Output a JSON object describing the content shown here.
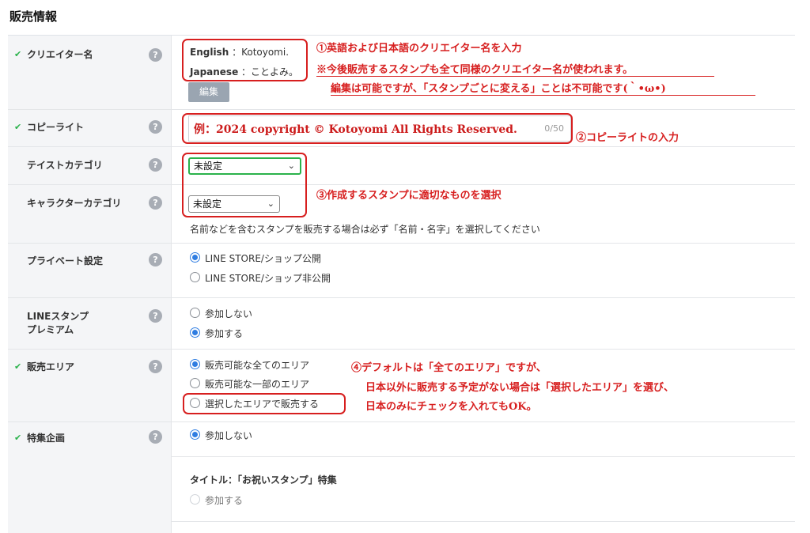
{
  "page_title": "販売情報",
  "help_glyph": "?",
  "check_glyph": "✔",
  "rows": {
    "creator": {
      "label": "クリエイター名",
      "english_label": "English",
      "english_value": "：Kotoyomi.",
      "japanese_label": "Japanese",
      "japanese_value": "：ことよみ。",
      "edit_button": "編集"
    },
    "copyright": {
      "label": "コピーライト",
      "placeholder": "例：2024 copyright © Kotoyomi All Rights Reserved.",
      "count": "0/50"
    },
    "taste": {
      "label": "テイストカテゴリ",
      "selected": "未設定"
    },
    "character": {
      "label": "キャラクターカテゴリ",
      "selected": "未設定",
      "note": "名前などを含むスタンプを販売する場合は必ず「名前・名字」を選択してください"
    },
    "private": {
      "label": "プライベート設定",
      "options": [
        "LINE STORE/ショップ公開",
        "LINE STORE/ショップ非公開"
      ],
      "selected_index": 0
    },
    "premium": {
      "label_line1": "LINEスタンプ",
      "label_line2": "プレミアム",
      "options": [
        "参加しない",
        "参加する"
      ],
      "selected_index": 1
    },
    "area": {
      "label": "販売エリア",
      "options": [
        "販売可能な全てのエリア",
        "販売可能な一部のエリア",
        "選択したエリアで販売する"
      ],
      "selected_index": 0
    },
    "feature": {
      "label": "特集企画",
      "option_top": "参加しない",
      "title_text": "タイトル：「お祝いスタンプ」特集",
      "option_bottom": "参加する"
    }
  },
  "annotations": {
    "a1_line1": "①英語および日本語のクリエイター名を入力",
    "a1_line2": "※今後販売するスタンプも全て同様のクリエイター名が使われます。",
    "a1_line3": "編集は可能ですが、「スタンプごとに変える」ことは不可能です(｀•ω•)",
    "a2": "②コピーライトの入力",
    "a3": "③作成するスタンプに適切なものを選択",
    "a4_line1": "④デフォルトは「全てのエリア」ですが、",
    "a4_line2": "日本以外に販売する予定がない場合は「選択したエリア」を選び、",
    "a4_line3": "日本のみにチェックを入れてもOK。"
  },
  "colors": {
    "annotation_red": "#d71f1f",
    "check_green": "#2ab24b",
    "radio_blue": "#2f7de1",
    "label_bg": "#f4f5f7"
  }
}
